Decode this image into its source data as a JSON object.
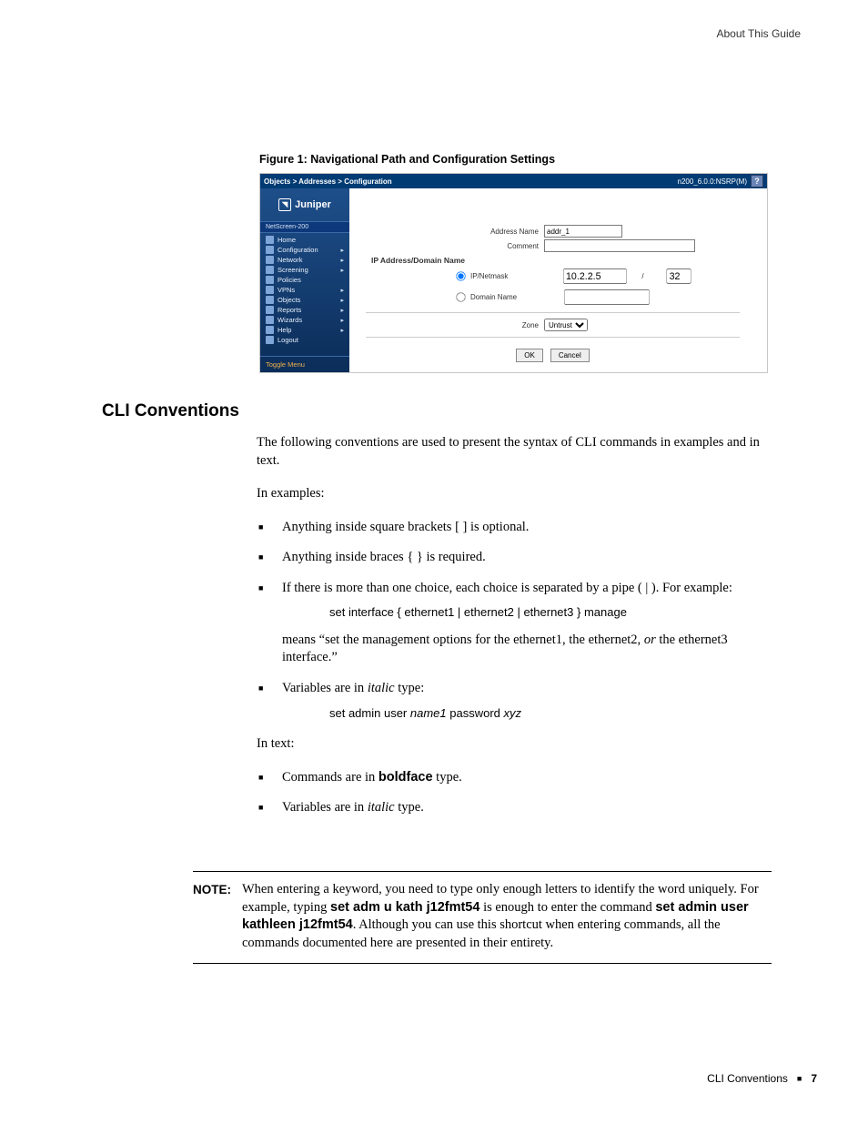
{
  "header": {
    "right": "About This Guide"
  },
  "figure": {
    "caption": "Figure 1:  Navigational Path and Configuration Settings"
  },
  "screenshot": {
    "breadcrumb": "Objects > Addresses > Configuration",
    "version_label": "n200_6.0.0:NSRP(M)",
    "help_glyph": "?",
    "brand": "Juniper",
    "device": "NetScreen-200",
    "nav_items": [
      {
        "label": "Home",
        "arrow": ""
      },
      {
        "label": "Configuration",
        "arrow": "▸"
      },
      {
        "label": "Network",
        "arrow": "▸"
      },
      {
        "label": "Screening",
        "arrow": "▸"
      },
      {
        "label": "Policies",
        "arrow": ""
      },
      {
        "label": "VPNs",
        "arrow": "▸"
      },
      {
        "label": "Objects",
        "arrow": "▸"
      },
      {
        "label": "Reports",
        "arrow": "▸"
      },
      {
        "label": "Wizards",
        "arrow": "▸"
      },
      {
        "label": "Help",
        "arrow": "▸"
      },
      {
        "label": "Logout",
        "arrow": ""
      }
    ],
    "toggle_menu": "Toggle Menu",
    "form": {
      "address_name_label": "Address Name",
      "address_name_value": "addr_1",
      "comment_label": "Comment",
      "comment_value": "",
      "section_head": "IP Address/Domain Name",
      "radio_ip_label": "IP/Netmask",
      "radio_domain_label": "Domain Name",
      "ip_value": "10.2.2.5",
      "mask_prefix": "/",
      "mask_value": "32",
      "zone_label": "Zone",
      "zone_value": "Untrust",
      "ok_label": "OK",
      "cancel_label": "Cancel"
    }
  },
  "section": {
    "title": "CLI Conventions"
  },
  "body": {
    "p1": "The following conventions are used to present the syntax of CLI commands in examples and in text.",
    "p2": "In examples:",
    "li1": "Anything inside square brackets [ ] is optional.",
    "li2": "Anything inside braces { } is required.",
    "li3a": "If there is more than one choice, each choice is separated by a pipe ( | ). For example:",
    "code1": "set interface { ethernet1 | ethernet2 | ethernet3 } manage",
    "li3b_a": "means “set the management options for the ethernet1, the ethernet2, ",
    "li3b_or": "or",
    "li3b_b": " the ethernet3 interface.”",
    "li4a": "Variables are in ",
    "li4_it": "italic",
    "li4b": " type:",
    "code2_a": "set admin user ",
    "code2_it1": "name1",
    "code2_b": " password ",
    "code2_it2": "xyz",
    "p3": "In text:",
    "li5a": "Commands are in ",
    "li5_bold": "boldface",
    "li5b": " type.",
    "li6a": "Variables are in ",
    "li6_it": "italic",
    "li6b": " type."
  },
  "note": {
    "tag": "NOTE:",
    "a": "When entering a keyword, you need to type only enough letters to identify the word uniquely. For example, typing ",
    "b1": "set adm u kath j12fmt54",
    "b": " is enough to enter the command ",
    "b2": "set admin user kathleen j12fmt54",
    "c": ". Although you can use this shortcut when entering commands, all the commands documented here are presented in their entirety."
  },
  "footer": {
    "title": "CLI Conventions",
    "page": "7"
  }
}
